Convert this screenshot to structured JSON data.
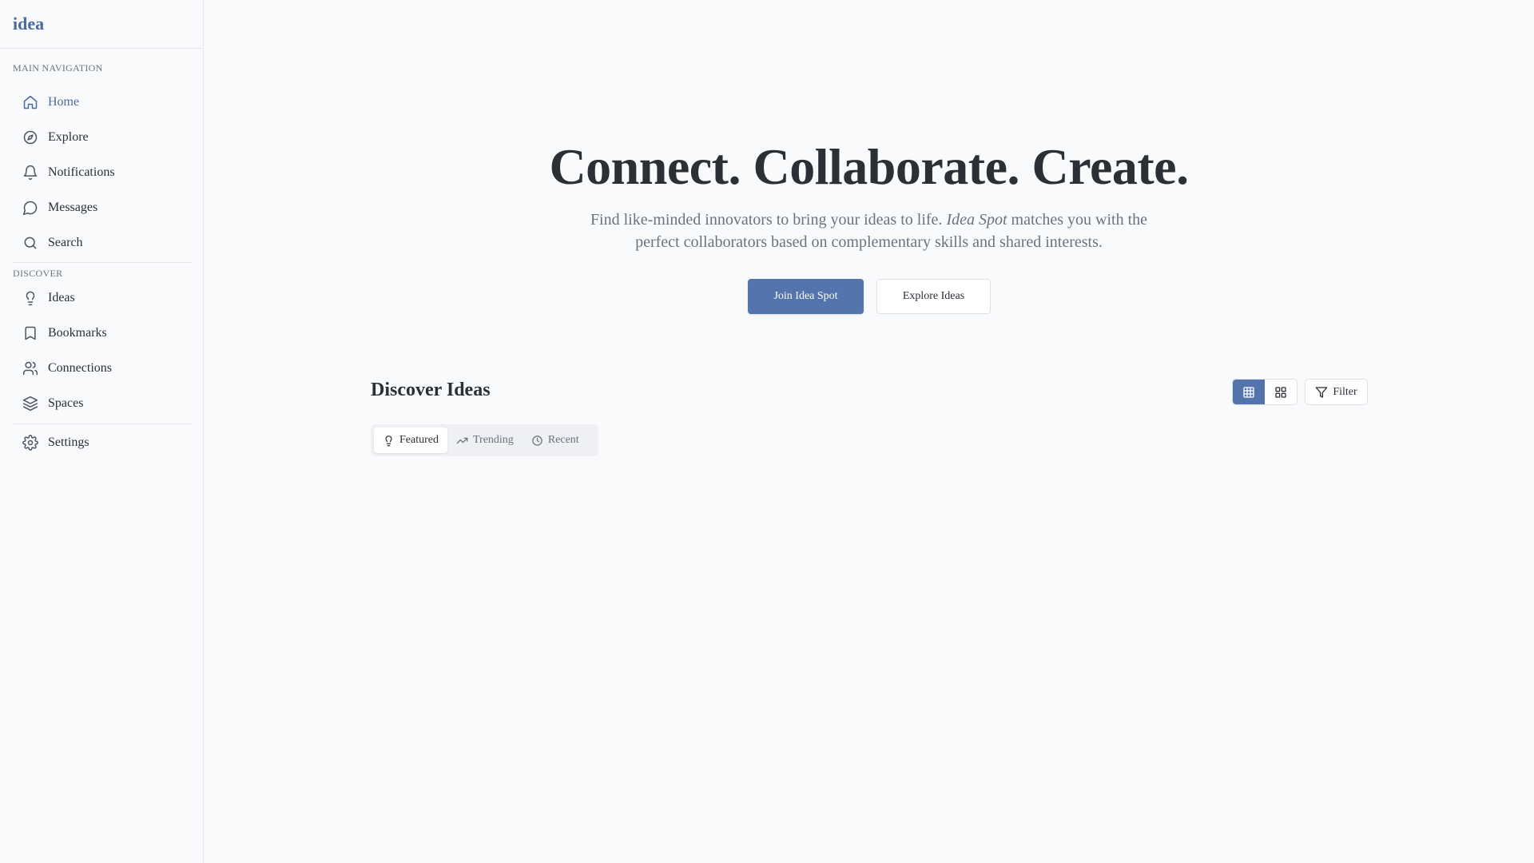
{
  "brand": {
    "logo": "idea"
  },
  "sidebar": {
    "main_label": "MAIN NAVIGATION",
    "main_items": [
      {
        "label": "Home",
        "icon": "home-icon",
        "active": true
      },
      {
        "label": "Explore",
        "icon": "compass-icon"
      },
      {
        "label": "Notifications",
        "icon": "bell-icon"
      },
      {
        "label": "Messages",
        "icon": "message-circle-icon"
      },
      {
        "label": "Search",
        "icon": "search-icon"
      }
    ],
    "discover_label": "DISCOVER",
    "discover_items": [
      {
        "label": "Ideas",
        "icon": "lightbulb-icon"
      },
      {
        "label": "Bookmarks",
        "icon": "bookmark-icon"
      },
      {
        "label": "Connections",
        "icon": "users-icon"
      },
      {
        "label": "Spaces",
        "icon": "layers-icon"
      }
    ],
    "settings": {
      "label": "Settings",
      "icon": "gear-icon"
    }
  },
  "hero": {
    "title": "Connect. Collaborate. Create.",
    "subtitle_pre": "Find like-minded innovators to bring your ideas to life. ",
    "subtitle_brand": "Idea Spot",
    "subtitle_post": " matches you with the",
    "subtitle_line2": "perfect collaborators based on complementary skills and shared interests.",
    "primary_button": "Join Idea Spot",
    "secondary_button": "Explore Ideas"
  },
  "discover": {
    "title": "Discover Ideas",
    "filter_label": "Filter",
    "view_modes": [
      {
        "name": "table",
        "icon": "table-icon",
        "active": true
      },
      {
        "name": "grid",
        "icon": "grid-icon"
      }
    ],
    "tabs": [
      {
        "label": "Featured",
        "icon": "lightbulb-icon",
        "active": true
      },
      {
        "label": "Trending",
        "icon": "trending-up-icon"
      },
      {
        "label": "Recent",
        "icon": "clock-icon"
      }
    ]
  },
  "colors": {
    "accent": "#5474ad",
    "logo": "#4a6aa5",
    "text": "#2b2f36",
    "muted": "#6b7280",
    "background": "#f9fafc"
  }
}
